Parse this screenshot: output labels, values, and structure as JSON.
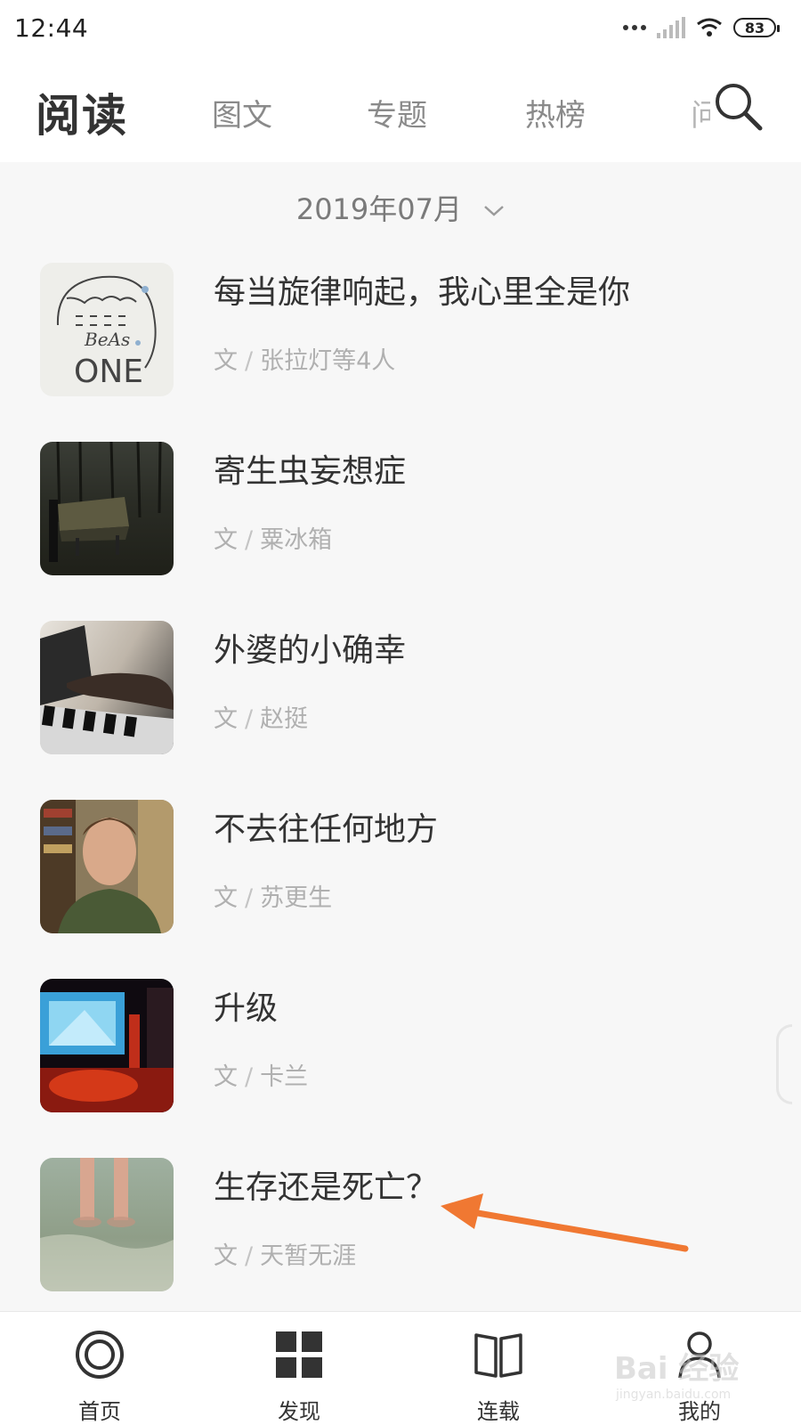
{
  "status_bar": {
    "time": "12:44",
    "battery": "83"
  },
  "header": {
    "title": "阅读",
    "tabs": [
      {
        "label": "图文"
      },
      {
        "label": "专题"
      },
      {
        "label": "热榜"
      },
      {
        "label": "问"
      }
    ]
  },
  "month_selector": {
    "label": "2019年07月"
  },
  "articles": [
    {
      "title": "每当旋律响起，我心里全是你",
      "author_prefix": "文",
      "author_sep": "/",
      "author": "张拉灯等4人"
    },
    {
      "title": "寄生虫妄想症",
      "author_prefix": "文",
      "author_sep": "/",
      "author": "粟冰箱"
    },
    {
      "title": "外婆的小确幸",
      "author_prefix": "文",
      "author_sep": "/",
      "author": "赵挺"
    },
    {
      "title": "不去往任何地方",
      "author_prefix": "文",
      "author_sep": "/",
      "author": "苏更生"
    },
    {
      "title": "升级",
      "author_prefix": "文",
      "author_sep": "/",
      "author": "卡兰"
    },
    {
      "title": "生存还是死亡？",
      "author_prefix": "文",
      "author_sep": "/",
      "author": "天暂无涯"
    }
  ],
  "thumb_text": {
    "line1": "BeAs",
    "line2": "ONE"
  },
  "bottom_nav": [
    {
      "label": "首页"
    },
    {
      "label": "发现"
    },
    {
      "label": "连载"
    },
    {
      "label": "我的"
    }
  ],
  "watermark": {
    "text": "Bai 经验",
    "sub": "jingyan.baidu.com"
  },
  "colors": {
    "arrow": "#f07832",
    "text_primary": "#333333",
    "text_secondary": "#b0b0b0"
  }
}
